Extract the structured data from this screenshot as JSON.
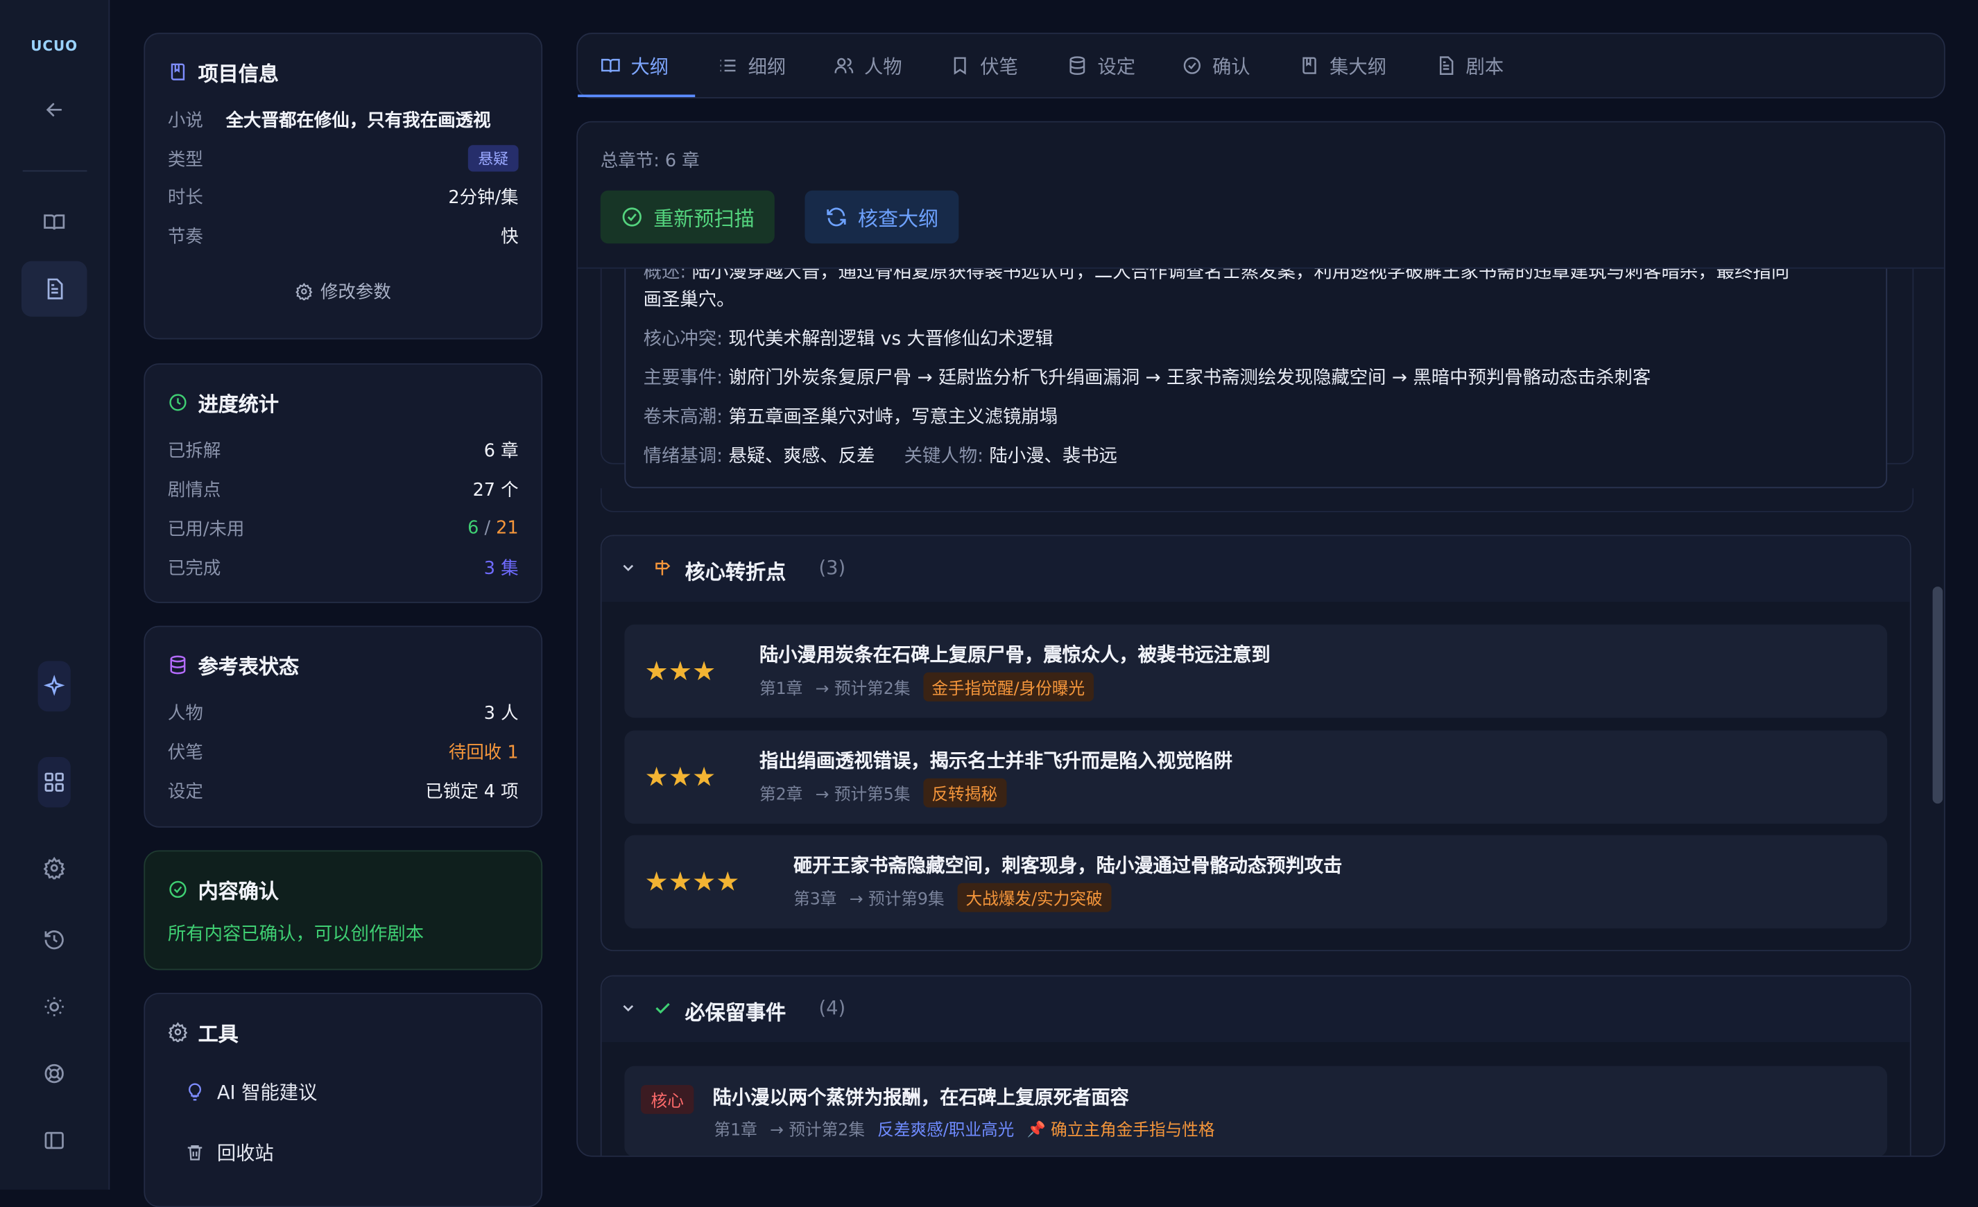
{
  "app": {
    "logo": "UCUO"
  },
  "project": {
    "title": "项目信息",
    "novel_label": "小说",
    "novel_value": "全大晋都在修仙，只有我在画透视",
    "type_label": "类型",
    "type_value": "悬疑",
    "duration_label": "时长",
    "duration_value": "2分钟/集",
    "pace_label": "节奏",
    "pace_value": "快",
    "edit_button": "修改参数"
  },
  "progress": {
    "title": "进度统计",
    "parsed_label": "已拆解",
    "parsed_value": "6 章",
    "plots_label": "剧情点",
    "plots_value": "27 个",
    "used_label": "已用/未用",
    "used_value": "6",
    "used_sep": " / ",
    "unused_value": "21",
    "done_label": "已完成",
    "done_value": "3 集"
  },
  "reference": {
    "title": "参考表状态",
    "people_label": "人物",
    "people_value": "3 人",
    "foreshadow_label": "伏笔",
    "foreshadow_value": "待回收 1",
    "setting_label": "设定",
    "setting_value": "已锁定 4 项"
  },
  "confirm": {
    "title": "内容确认",
    "text": "所有内容已确认，可以创作剧本"
  },
  "tools": {
    "title": "工具",
    "ai": "AI 智能建议",
    "trash": "回收站"
  },
  "tabs": [
    "大纲",
    "细纲",
    "人物",
    "伏笔",
    "设定",
    "确认",
    "集大纲",
    "剧本"
  ],
  "outline": {
    "total": "总章节: 6 章",
    "rescan_button": "重新预扫描",
    "check_button": "核查大纲",
    "summary_label": "概述:",
    "summary_text": "陆小漫穿越大晋，通过骨相复原获得裴书远认可，二人合作调查名士蒸发案，利用透视学破解王家书斋的违章建筑与刺客暗杀，最终指向",
    "summary_text2": "画圣巢穴。",
    "conflict_label": "核心冲突:",
    "conflict_value": "现代美术解剖逻辑 vs 大晋修仙幻术逻辑",
    "events_label": "主要事件:",
    "events_value": "谢府门外炭条复原尸骨 → 廷尉监分析飞升绢画漏洞 → 王家书斋测绘发现隐藏空间 → 黑暗中预判骨骼动态击杀刺客",
    "climax_label": "卷末高潮:",
    "climax_value": "第五章画圣巢穴对峙，写意主义滤镜崩塌",
    "mood_label": "情绪基调:",
    "mood_value": "悬疑、爽感、反差",
    "key_label": "关键人物:",
    "key_value": "陆小漫、裴书远"
  },
  "turning_points": {
    "title": "核心转折点",
    "count": "(3)",
    "items": [
      {
        "stars": "★★★",
        "title": "陆小漫用炭条在石碑上复原尸骨，震惊众人，被裴书远注意到",
        "chapter": "第1章",
        "plan": "→ 预计第2集",
        "tag": "金手指觉醒/身份曝光"
      },
      {
        "stars": "★★★",
        "title": "指出绢画透视错误，揭示名士并非飞升而是陷入视觉陷阱",
        "chapter": "第2章",
        "plan": "→ 预计第5集",
        "tag": "反转揭秘"
      },
      {
        "stars": "★★★★",
        "title": "砸开王家书斋隐藏空间，刺客现身，陆小漫通过骨骼动态预判攻击",
        "chapter": "第3章",
        "plan": "→ 预计第9集",
        "tag": "大战爆发/实力突破"
      }
    ]
  },
  "must_keep": {
    "title": "必保留事件",
    "count": "(4)",
    "items": [
      {
        "badge": "核心",
        "title": "陆小漫以两个蒸饼为报酬，在石碑上复原死者面容",
        "chapter": "第1章",
        "plan": "→ 预计第2集",
        "tag": "反差爽感/职业高光",
        "pin_icon": "📌",
        "pin": "确立主角金手指与性格"
      }
    ]
  },
  "colors": {
    "accent": "#5b8cff",
    "green": "#54d47e",
    "orange": "#f5963b",
    "star": "#f3b433"
  }
}
